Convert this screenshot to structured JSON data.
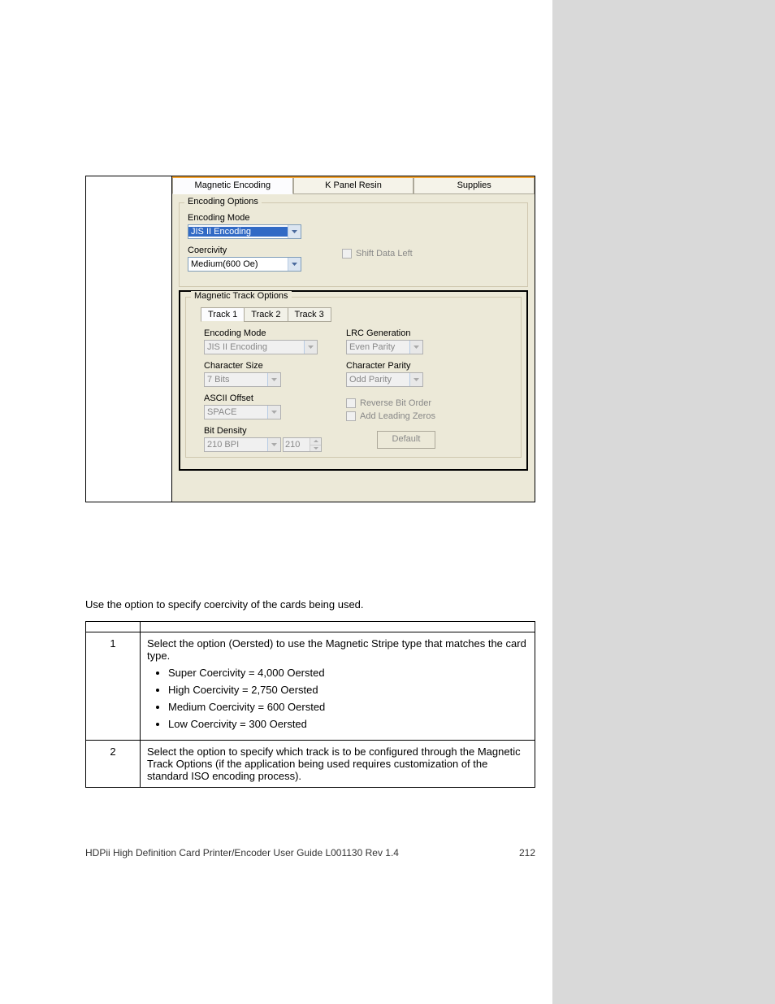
{
  "dialog": {
    "tabs": {
      "magnetic": "Magnetic Encoding",
      "kpanel": "K Panel Resin",
      "supplies": "Supplies"
    },
    "encoding": {
      "title": "Encoding Options",
      "mode_label": "Encoding Mode",
      "mode_value": "JIS II Encoding",
      "coercivity_label": "Coercivity",
      "coercivity_value": "Medium(600 Oe)",
      "shift_label": "Shift Data Left"
    },
    "track": {
      "title": "Magnetic Track Options",
      "tabs": {
        "t1": "Track 1",
        "t2": "Track 2",
        "t3": "Track 3"
      },
      "mode_label": "Encoding Mode",
      "mode_value": "JIS II Encoding",
      "charsize_label": "Character Size",
      "charsize_value": "7 Bits",
      "ascii_label": "ASCII Offset",
      "ascii_value": "SPACE",
      "bitdensity_label": "Bit Density",
      "bitdensity_value": "210 BPI",
      "bitdensity_spin": "210",
      "lrc_label": "LRC Generation",
      "lrc_value": "Even Parity",
      "charparity_label": "Character Parity",
      "charparity_value": "Odd Parity",
      "reverse_label": "Reverse Bit Order",
      "leading_label": "Add Leading Zeros",
      "default_btn": "Default"
    }
  },
  "body": {
    "intro_a": "Use the ",
    "intro_b": " option to specify coercivity of the cards being used."
  },
  "table": {
    "hdr_step": "",
    "hdr_proc": "",
    "row1_num": "1",
    "row1_a": "Select the ",
    "row1_b": " option (Oersted) to use the Magnetic Stripe type that matches the card type.",
    "row1_li1": "Super Coercivity = 4,000 Oersted",
    "row1_li2": "High Coercivity = 2,750 Oersted",
    "row1_li3": "Medium Coercivity = 600 Oersted",
    "row1_li4": "Low Coercivity = 300 Oersted",
    "row2_num": "2",
    "row2_a": "Select the ",
    "row2_b": " option to specify which track is to be configured through the Magnetic Track Options (if the application being used requires customization of the standard ISO encoding process)."
  },
  "footer": {
    "left": "HDPii High Definition Card Printer/Encoder User Guide    L001130 Rev 1.4",
    "right": "212"
  }
}
